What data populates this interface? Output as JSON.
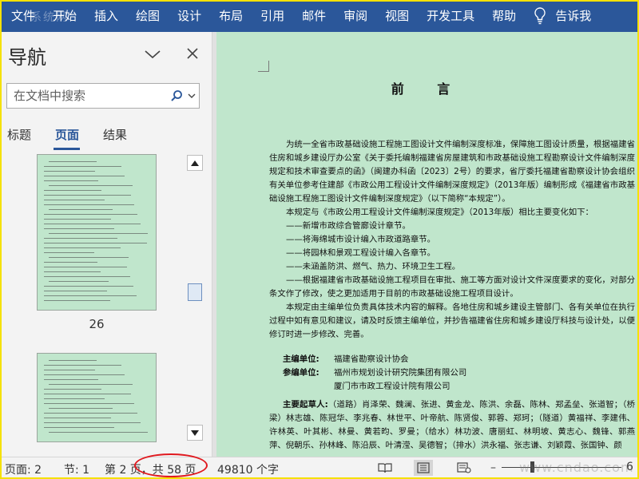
{
  "ribbon": {
    "tabs": [
      "文件",
      "开始",
      "插入",
      "绘图",
      "设计",
      "布局",
      "引用",
      "邮件",
      "审阅",
      "视图",
      "开发工具",
      "帮助"
    ],
    "tell_me": "告诉我",
    "watermark": "系统网"
  },
  "nav": {
    "title": "导航",
    "search_placeholder": "在文档中搜索",
    "tabs": [
      "标题",
      "页面",
      "结果"
    ],
    "thumb_label": "26"
  },
  "doc": {
    "title": "前 言",
    "paragraphs": [
      "为统一全省市政基础设施工程施工图设计文件编制深度标准，保障施工图设计质量，根据福建省住房和城乡建设厅办公室《关于委托编制福建省房屋建筑和市政基础设施工程勘察设计文件编制深度规定和技术审查要点的函》（闽建办科函〔2023〕2号）的要求，省厅委托福建省勘察设计协会组织有关单位参考住建部《市政公用工程设计文件编制深度规定》（2013年版）编制形成《福建省市政基础设施工程施工图设计文件编制深度规定》（以下简称“本规定”）。",
      "本规定与《市政公用工程设计文件编制深度规定》（2013年版）相比主要变化如下："
    ],
    "dashes": [
      "——新增市政综合管廊设计章节。",
      "——将海绵城市设计编入市政道路章节。",
      "——将园林和景观工程设计编入各章节。",
      "——未涵盖防洪、燃气、热力、环境卫生工程。",
      "——根据福建省市政基础设施工程项目在审批、施工等方面对设计文件深度要求的变化，对部分条文作了修改，使之更加适用于目前的市政基础设施工程项目设计。"
    ],
    "closing": "本规定由主编单位负责具体技术内容的解释。各地住房和城乡建设主管部门、各有关单位在执行过程中如有意见和建议，请及时反馈主编单位，并抄告福建省住房和城乡建设厅科技与设计处，以便修订时进一步修改、完善。",
    "chief_label": "主编单位:",
    "chief_value": "福建省勘察设计协会",
    "co_label": "参编单位:",
    "co_values": [
      "福州市规划设计研究院集团有限公司",
      "厦门市市政工程设计院有限公司"
    ],
    "drafters_label": "主要起草人:",
    "drafters_text": "（道路）肖泽荣、魏澜、张进、黄金龙、陈洪、余磊、陈林、郑孟垒、张道智；（桥梁）林志雄、陈冠华、李兆春、林世平、叶帝航、陈贤俊、郭蓉、郑珂；（隧道）黄福祥、李建伟、许林英、叶其彬、林曼、黄若昀、罗曼；（给水）林功波、唐丽虹、林明坡、黄志心、魏锋、郭燕萍、倪朝乐、孙林峰、陈沿辰、叶清滢、吴德智；（排水）洪永福、张志谦、刘颖霞、张国钟、颜"
  },
  "status": {
    "page": "页面: 2",
    "section": "节: 1",
    "page_of": "第 2 页，共 58 页",
    "words": "49810 个字",
    "zoom": "6",
    "watermark": "www.cndao.com"
  }
}
